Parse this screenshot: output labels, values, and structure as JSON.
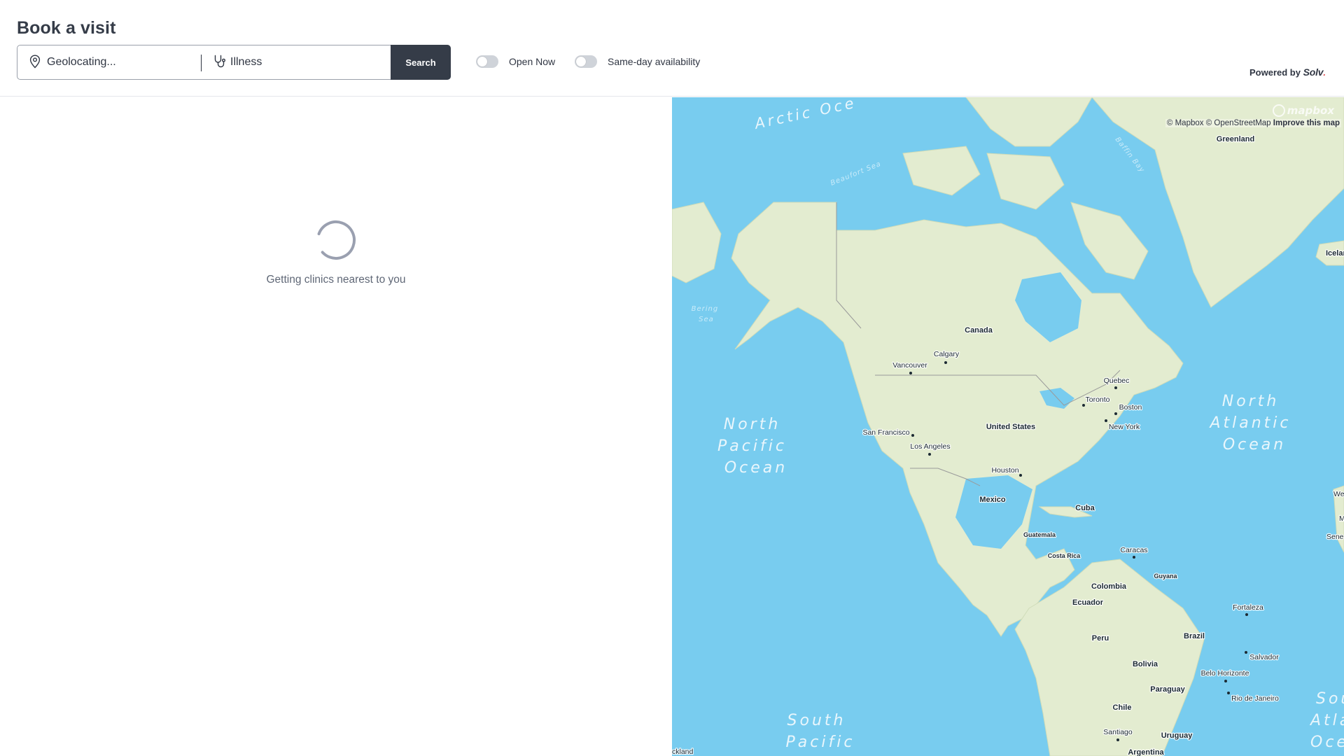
{
  "header": {
    "title": "Book a visit",
    "search": {
      "location_placeholder": "Geolocating...",
      "location_icon": "map-pin-icon",
      "reason_placeholder": "Illness",
      "reason_icon": "stethoscope-icon",
      "button_label": "Search"
    },
    "filters": [
      {
        "label": "Open Now",
        "enabled": false
      },
      {
        "label": "Same-day availability",
        "enabled": false
      }
    ],
    "powered_by": {
      "prefix": "Powered by",
      "brand": "Solv",
      "brand_suffix": "."
    }
  },
  "results": {
    "loading_text": "Getting clinics nearest to you",
    "spinner_icon": "loading-spinner-icon"
  },
  "map": {
    "attribution": {
      "mapbox": "© Mapbox",
      "osm": "© OpenStreetMap",
      "improve_link": "Improve this map"
    },
    "logo": "mapbox",
    "oceans": [
      {
        "id": "arctic",
        "lines": [
          "Arctic Oce"
        ]
      },
      {
        "id": "north-pacific",
        "lines": [
          "North",
          "Pacific",
          "Ocean"
        ]
      },
      {
        "id": "north-atlantic",
        "lines": [
          "North",
          "Atlantic",
          "Ocean"
        ]
      },
      {
        "id": "south-pacific",
        "lines": [
          "South",
          "Pacific"
        ]
      },
      {
        "id": "south-atlantic",
        "lines": [
          "Sou",
          "Atla",
          "Oce"
        ]
      }
    ],
    "seas": [
      {
        "id": "beaufort",
        "lines": [
          "Beaufort Sea"
        ]
      },
      {
        "id": "baffin",
        "lines": [
          "Baffin Bay"
        ]
      },
      {
        "id": "bering",
        "lines": [
          "Bering",
          "Sea"
        ]
      }
    ],
    "countries": [
      "Greenland",
      "Iceland",
      "Canada",
      "United States",
      "Mexico",
      "Cuba",
      "Guatemala",
      "Costa Rica",
      "Guyana",
      "Colombia",
      "Ecuador",
      "Peru",
      "Brazil",
      "Bolivia",
      "Paraguay",
      "Chile",
      "Uruguay",
      "Argentina"
    ],
    "cities": [
      "Calgary",
      "Vancouver",
      "Quebec",
      "Toronto",
      "Boston",
      "New York",
      "San Francisco",
      "Los Angeles",
      "Houston",
      "Caracas",
      "Fortaleza",
      "Salvador",
      "Belo Horizonte",
      "Rio de Janeiro",
      "Santiago",
      "ckland"
    ],
    "edge_labels": [
      "We",
      "M",
      "Sene"
    ]
  }
}
